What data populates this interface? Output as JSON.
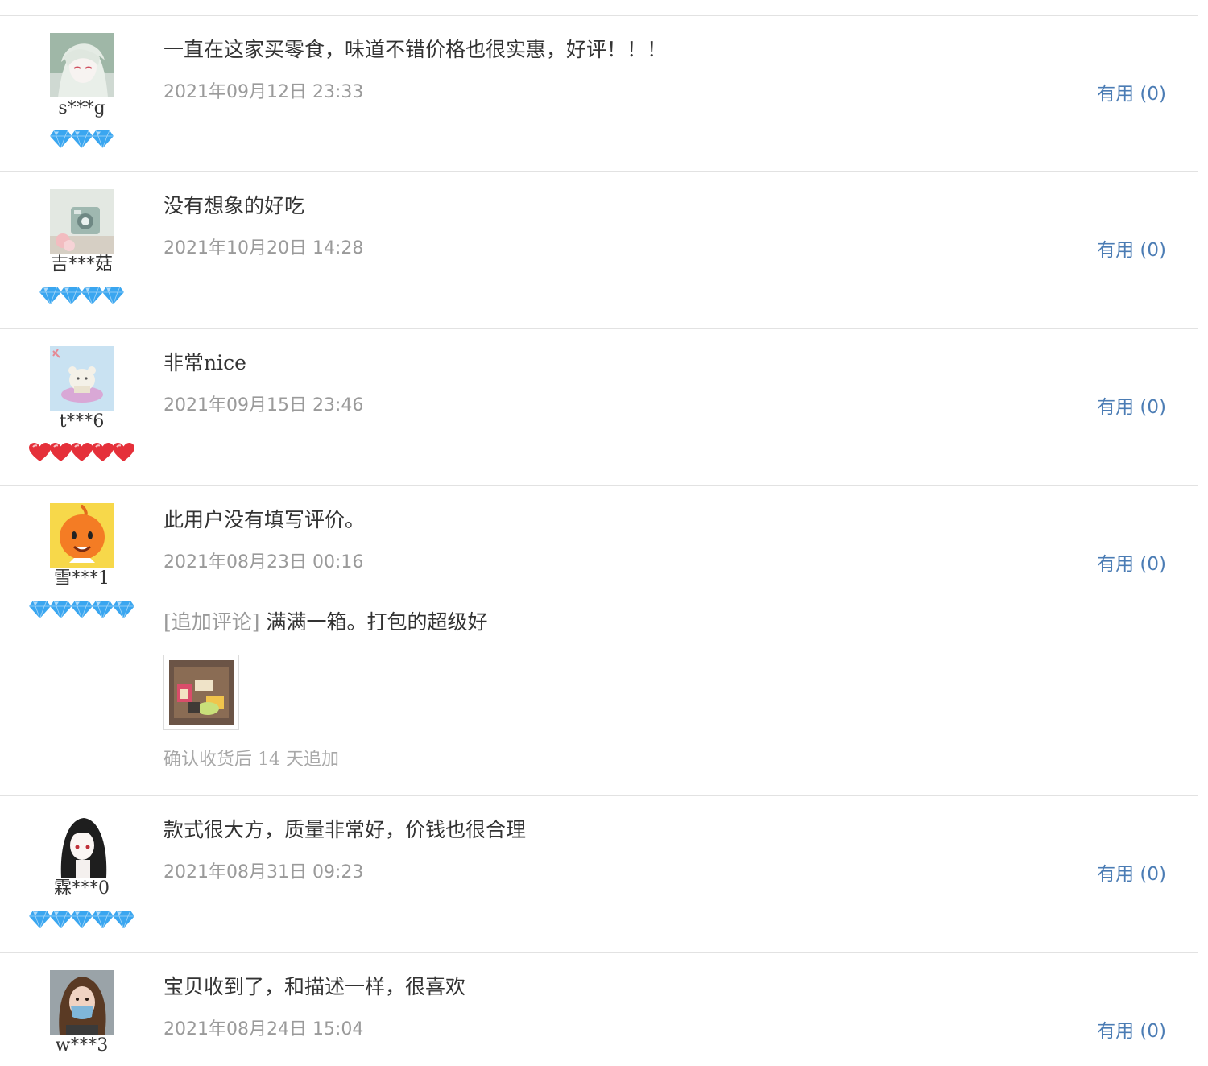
{
  "reviews": [
    {
      "username": "s***g",
      "level_icon": "diamond-icon",
      "level_count": 3,
      "level_color": "#3aa6f0",
      "text": "一直在这家买零食，味道不错价格也很实惠，好评！！！",
      "date": "2021年09月12日 23:33",
      "useful": "有用 (0)"
    },
    {
      "username": "吉***菇",
      "level_icon": "diamond-icon",
      "level_count": 4,
      "level_color": "#3aa6f0",
      "text": "没有想象的好吃",
      "date": "2021年10月20日 14:28",
      "useful": "有用 (0)"
    },
    {
      "username": "t***6",
      "level_icon": "heart-icon",
      "level_count": 5,
      "level_color": "#e5303a",
      "text": "非常nice",
      "date": "2021年09月15日 23:46",
      "useful": "有用 (0)"
    },
    {
      "username": "雪***1",
      "level_icon": "diamond-icon",
      "level_count": 5,
      "level_color": "#3aa6f0",
      "text": "此用户没有填写评价。",
      "date": "2021年08月23日 00:16",
      "useful": "有用 (0)",
      "append": {
        "tag": "[追加评论]",
        "text": " 满满一箱。打包的超级好",
        "photo_icon": "review-photo-thumbnail",
        "note": "确认收货后 14 天追加"
      }
    },
    {
      "username": "霖***0",
      "level_icon": "diamond-icon",
      "level_count": 5,
      "level_color": "#3aa6f0",
      "text": "款式很大方，质量非常好，价钱也很合理",
      "date": "2021年08月31日 09:23",
      "useful": "有用 (0)"
    },
    {
      "username": "w***3",
      "level_icon": "diamond-icon",
      "level_count": 0,
      "level_color": "#3aa6f0",
      "text": "宝贝收到了，和描述一样，很喜欢",
      "date": "2021年08月24日 15:04",
      "useful": "有用 (0)"
    }
  ],
  "colors": {
    "text": "#333333",
    "date": "#9a9a9a",
    "link": "#4b7cb4",
    "divider": "#e2e2e2",
    "diamond": "#3aa6f0",
    "heart": "#e5303a"
  }
}
